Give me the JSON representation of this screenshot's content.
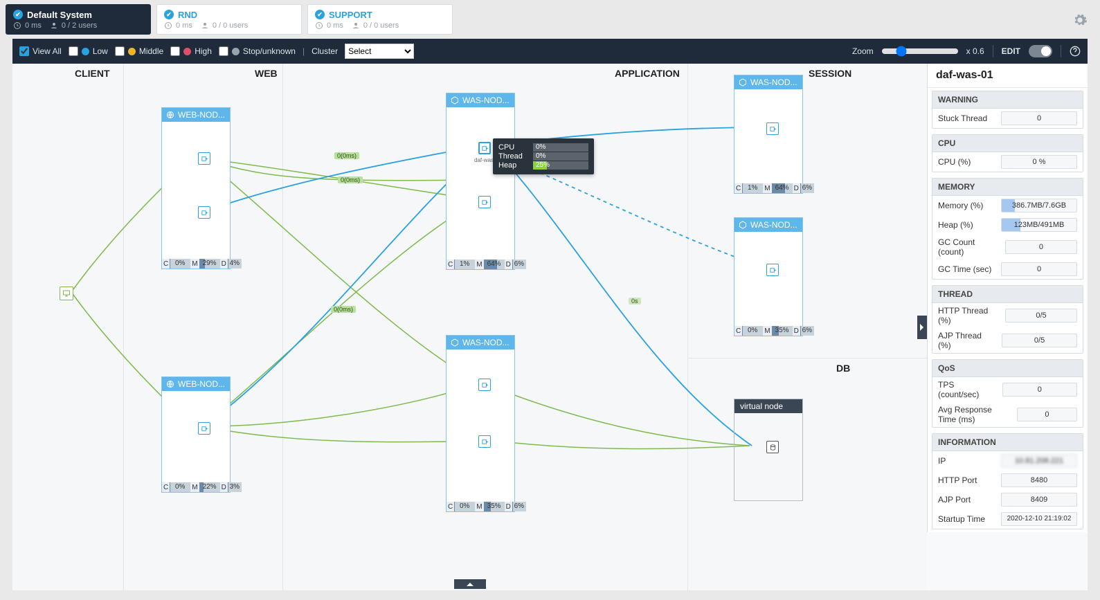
{
  "systems": [
    {
      "name": "Default System",
      "ms": "0 ms",
      "users": "0 / 2 users",
      "active": true
    },
    {
      "name": "RND",
      "ms": "0 ms",
      "users": "0 / 0 users",
      "active": false
    },
    {
      "name": "SUPPORT",
      "ms": "0 ms",
      "users": "0 / 0 users",
      "active": false
    }
  ],
  "filter": {
    "viewall": "View All",
    "low": "Low",
    "middle": "Middle",
    "high": "High",
    "stop": "Stop/unknown",
    "cluster_label": "Cluster",
    "cluster_sel": "Select",
    "colors": {
      "low": "#2aa1e0",
      "middle": "#f0b429",
      "high": "#e04f6a",
      "stop": "#9aa4ad"
    },
    "zoom_label": "Zoom",
    "zoom_val": "x 0.6",
    "edit": "EDIT"
  },
  "columns": {
    "client": "CLIENT",
    "web": "WEB",
    "app": "APPLICATION",
    "session": "SESSION",
    "db": "DB"
  },
  "nodes": {
    "web1": {
      "title": "WEB-NOD...",
      "c": "0%",
      "m": "29%",
      "d": "4%",
      "mfill": 29,
      "dfill": 4
    },
    "web2": {
      "title": "WEB-NOD...",
      "c": "0%",
      "m": "22%",
      "d": "3%",
      "mfill": 22,
      "dfill": 3
    },
    "was1": {
      "title": "WAS-NOD...",
      "c": "1%",
      "m": "64%",
      "d": "6%",
      "mfill": 64,
      "dfill": 6
    },
    "was2": {
      "title": "WAS-NOD...",
      "c": "0%",
      "m": "35%",
      "d": "6%",
      "mfill": 35,
      "dfill": 6
    },
    "was3": {
      "title": "WAS-NOD...",
      "c": "1%",
      "m": "64%",
      "d": "6%",
      "mfill": 64,
      "dfill": 6
    },
    "was4": {
      "title": "WAS-NOD...",
      "c": "0%",
      "m": "35%",
      "d": "6%",
      "mfill": 35,
      "dfill": 6
    },
    "virtual": {
      "title": "virtual node"
    }
  },
  "tooltip": {
    "node_label": "daf-was-0...",
    "rows": [
      {
        "label": "CPU",
        "val": "0%",
        "pct": 0,
        "color": "#9aa4ad"
      },
      {
        "label": "Thread",
        "val": "0%",
        "pct": 0,
        "color": "#9aa4ad"
      },
      {
        "label": "Heap",
        "val": "25%",
        "pct": 25,
        "color": "#8bd33c"
      }
    ]
  },
  "link_labels": {
    "l1": "0(0ms)",
    "l2": "0(0ms)",
    "l3": "0(0ms)",
    "l4": "0s"
  },
  "side": {
    "title": "daf-was-01",
    "warning": {
      "h": "WARNING",
      "stuck_label": "Stuck Thread",
      "stuck_val": "0"
    },
    "cpu": {
      "h": "CPU",
      "label": "CPU (%)",
      "val": "0 %",
      "pct": 0
    },
    "memory": {
      "h": "MEMORY",
      "mem_label": "Memory (%)",
      "mem_val": "386.7MB/7.6GB",
      "mem_pct": 5,
      "heap_label": "Heap (%)",
      "heap_val": "123MB/491MB",
      "heap_pct": 25,
      "gcc_label": "GC Count (count)",
      "gcc_val": "0",
      "gct_label": "GC Time (sec)",
      "gct_val": "0"
    },
    "thread": {
      "h": "THREAD",
      "http_label": "HTTP Thread (%)",
      "http_val": "0/5",
      "ajp_label": "AJP Thread (%)",
      "ajp_val": "0/5"
    },
    "qos": {
      "h": "QoS",
      "tps_label": "TPS (count/sec)",
      "tps_val": "0",
      "avg_label": "Avg Response Time (ms)",
      "avg_val": "0"
    },
    "info": {
      "h": "INFORMATION",
      "ip_label": "IP",
      "ip_val": "10.81.208.221",
      "http_label": "HTTP Port",
      "http_val": "8480",
      "ajp_label": "AJP Port",
      "ajp_val": "8409",
      "st_label": "Startup Time",
      "st_val": "2020-12-10 21:19:02"
    }
  }
}
